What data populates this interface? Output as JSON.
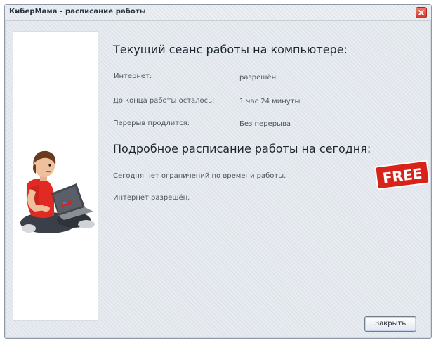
{
  "window": {
    "title": "КиберМама - расписание работы"
  },
  "current_session": {
    "heading": "Текущий сеанс работы на компьютере:",
    "rows": [
      {
        "label": "Интернет:",
        "value": "разрешён"
      },
      {
        "label": "До конца работы осталось:",
        "value": "1 час 24 минуты"
      },
      {
        "label": "Перерыв продлится:",
        "value": "Без перерыва"
      }
    ]
  },
  "schedule": {
    "heading": "Подробное расписание работы на сегодня:",
    "lines": [
      "Сегодня нет ограничений по времени работы.",
      "Интернет разрешён."
    ]
  },
  "badge": {
    "text": "FREE",
    "color": "#d8231b"
  },
  "buttons": {
    "close_label": "Закрыть"
  },
  "icons": {
    "close": "close-x-icon",
    "illustration": "boy-with-laptop-illustration"
  }
}
